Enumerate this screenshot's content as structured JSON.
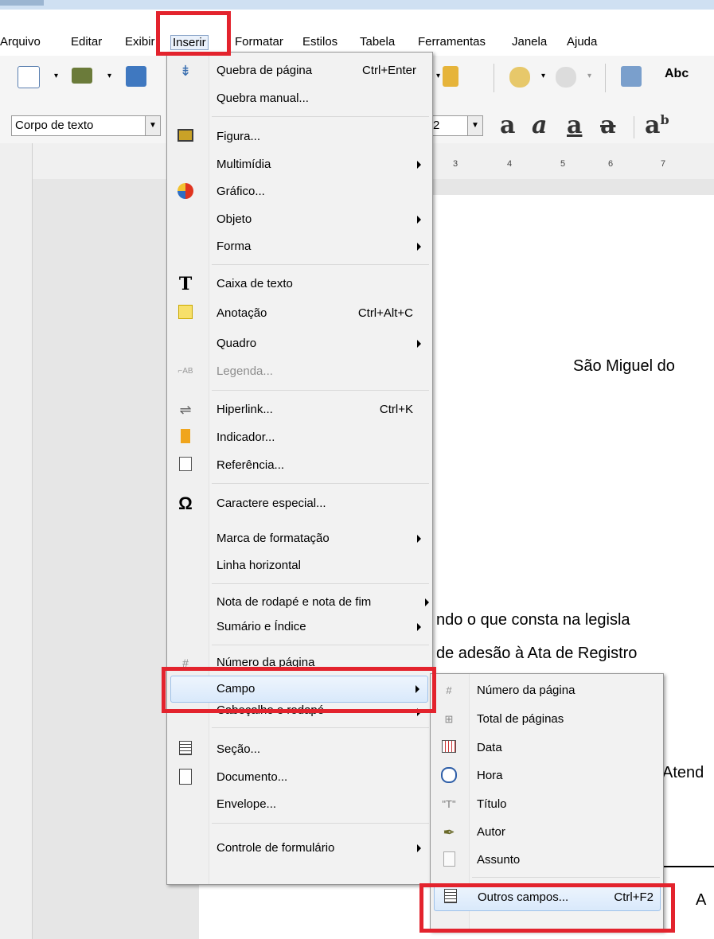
{
  "menubar": [
    "Arquivo",
    "Editar",
    "Exibir",
    "Inserir",
    "Formatar",
    "Estilos",
    "Tabela",
    "Ferramentas",
    "Janela",
    "Ajuda"
  ],
  "toolbar": {
    "paragraph_style": "Corpo de texto",
    "font_size": "2"
  },
  "ruler_ticks": [
    "3",
    "4",
    "5",
    "6",
    "7"
  ],
  "insert_menu": {
    "items": [
      {
        "label": "Quebra de página",
        "shortcut": "Ctrl+Enter",
        "icon": "page-break-icon"
      },
      {
        "label": "Quebra manual...",
        "shortcut": "",
        "icon": ""
      },
      {
        "label": "Figura...",
        "shortcut": "",
        "icon": "image-icon"
      },
      {
        "label": "Multimídia",
        "shortcut": "",
        "icon": ""
      },
      {
        "label": "Gráfico...",
        "shortcut": "",
        "icon": "chart-icon"
      },
      {
        "label": "Objeto",
        "shortcut": "",
        "icon": ""
      },
      {
        "label": "Forma",
        "shortcut": "",
        "icon": ""
      },
      {
        "label": "Caixa de texto",
        "shortcut": "",
        "icon": "text-box-icon"
      },
      {
        "label": "Anotação",
        "shortcut": "Ctrl+Alt+C",
        "icon": "comment-icon"
      },
      {
        "label": "Quadro",
        "shortcut": "",
        "icon": ""
      },
      {
        "label": "Legenda...",
        "shortcut": "",
        "icon": "caption-icon"
      },
      {
        "label": "Hiperlink...",
        "shortcut": "Ctrl+K",
        "icon": "hyperlink-icon"
      },
      {
        "label": "Indicador...",
        "shortcut": "",
        "icon": "bookmark-icon"
      },
      {
        "label": "Referência...",
        "shortcut": "",
        "icon": "cross-reference-icon"
      },
      {
        "label": "Caractere especial...",
        "shortcut": "",
        "icon": "omega-icon"
      },
      {
        "label": "Marca de formatação",
        "shortcut": "",
        "icon": ""
      },
      {
        "label": "Linha horizontal",
        "shortcut": "",
        "icon": ""
      },
      {
        "label": "Nota de rodapé e nota de fim",
        "shortcut": "",
        "icon": ""
      },
      {
        "label": "Sumário e Índice",
        "shortcut": "",
        "icon": ""
      },
      {
        "label": "Número da página",
        "shortcut": "",
        "icon": "page-number-icon"
      },
      {
        "label": "Campo",
        "shortcut": "",
        "icon": ""
      },
      {
        "label": "Cabeçalho e rodapé",
        "shortcut": "",
        "icon": ""
      },
      {
        "label": "Seção...",
        "shortcut": "",
        "icon": "section-icon"
      },
      {
        "label": "Documento...",
        "shortcut": "",
        "icon": "document-icon"
      },
      {
        "label": "Envelope...",
        "shortcut": "",
        "icon": ""
      },
      {
        "label": "Controle de formulário",
        "shortcut": "",
        "icon": ""
      }
    ]
  },
  "field_submenu": {
    "items": [
      {
        "label": "Número da página",
        "shortcut": "",
        "icon": "page-number-icon"
      },
      {
        "label": "Total de páginas",
        "shortcut": "",
        "icon": "page-count-icon"
      },
      {
        "label": "Data",
        "shortcut": "",
        "icon": "calendar-icon"
      },
      {
        "label": "Hora",
        "shortcut": "",
        "icon": "clock-icon"
      },
      {
        "label": "Título",
        "shortcut": "",
        "icon": "title-icon"
      },
      {
        "label": "Autor",
        "shortcut": "",
        "icon": "author-icon"
      },
      {
        "label": "Assunto",
        "shortcut": "",
        "icon": "subject-icon"
      },
      {
        "label": "Outros campos...",
        "shortcut": "Ctrl+F2",
        "icon": "more-fields-icon"
      }
    ]
  },
  "document": {
    "line1": "São Miguel do",
    "line2": "ndo o que consta na legisla",
    "line3": "de adesão à Ata de Registro",
    "line4": "Atend",
    "line5": "A"
  },
  "colors": {
    "highlight": "#e3232d"
  }
}
